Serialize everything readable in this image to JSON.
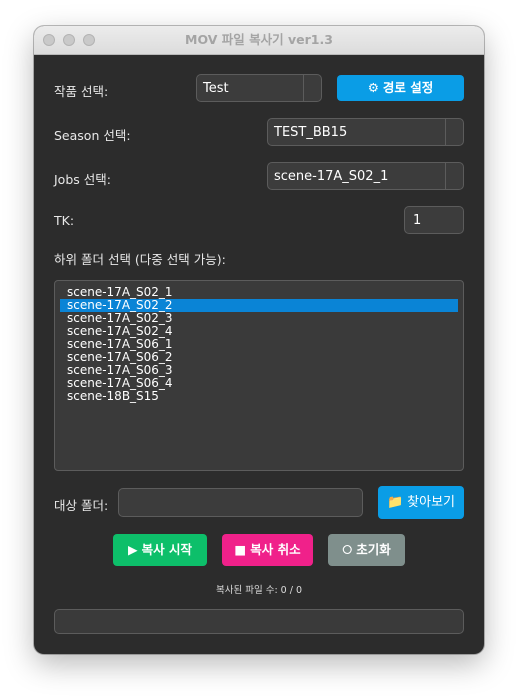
{
  "window": {
    "title": "MOV 파일 복사기 ver1.3"
  },
  "colors": {
    "accent": "#0a9de6",
    "start": "#0dbf6a",
    "cancel": "#f0218a",
    "reset": "#7f8f8c",
    "background": "#2c2c2c"
  },
  "project": {
    "label": "작품 선택:",
    "value": "Test",
    "path_button": {
      "icon": "⚙",
      "label": "경로 설정"
    }
  },
  "season": {
    "label": "Season 선택:",
    "value": "TEST_BB15"
  },
  "jobs": {
    "label": "Jobs 선택:",
    "value": "scene-17A_S02_1"
  },
  "tk": {
    "label": "TK:",
    "value": "1"
  },
  "subfolders": {
    "label": "하위 폴더 선택 (다중 선택 가능):",
    "items": [
      "scene-17A_S02_1",
      "scene-17A_S02_2",
      "scene-17A_S02_3",
      "scene-17A_S02_4",
      "scene-17A_S06_1",
      "scene-17A_S06_2",
      "scene-17A_S06_3",
      "scene-17A_S06_4",
      "scene-18B_S15"
    ],
    "selected_index": 1
  },
  "target": {
    "label": "대상 폴더:",
    "value": "",
    "browse_button": {
      "icon": "📁",
      "label": "찾아보기"
    }
  },
  "actions": {
    "start": {
      "icon": "▶",
      "label": "복사 시작"
    },
    "cancel": {
      "icon": "■",
      "label": "복사 취소"
    },
    "reset": {
      "icon": "⭘",
      "label": "초기화"
    }
  },
  "status": {
    "count_text": "복사된 파일 수: 0 / 0"
  },
  "progress": {
    "value": 0
  }
}
